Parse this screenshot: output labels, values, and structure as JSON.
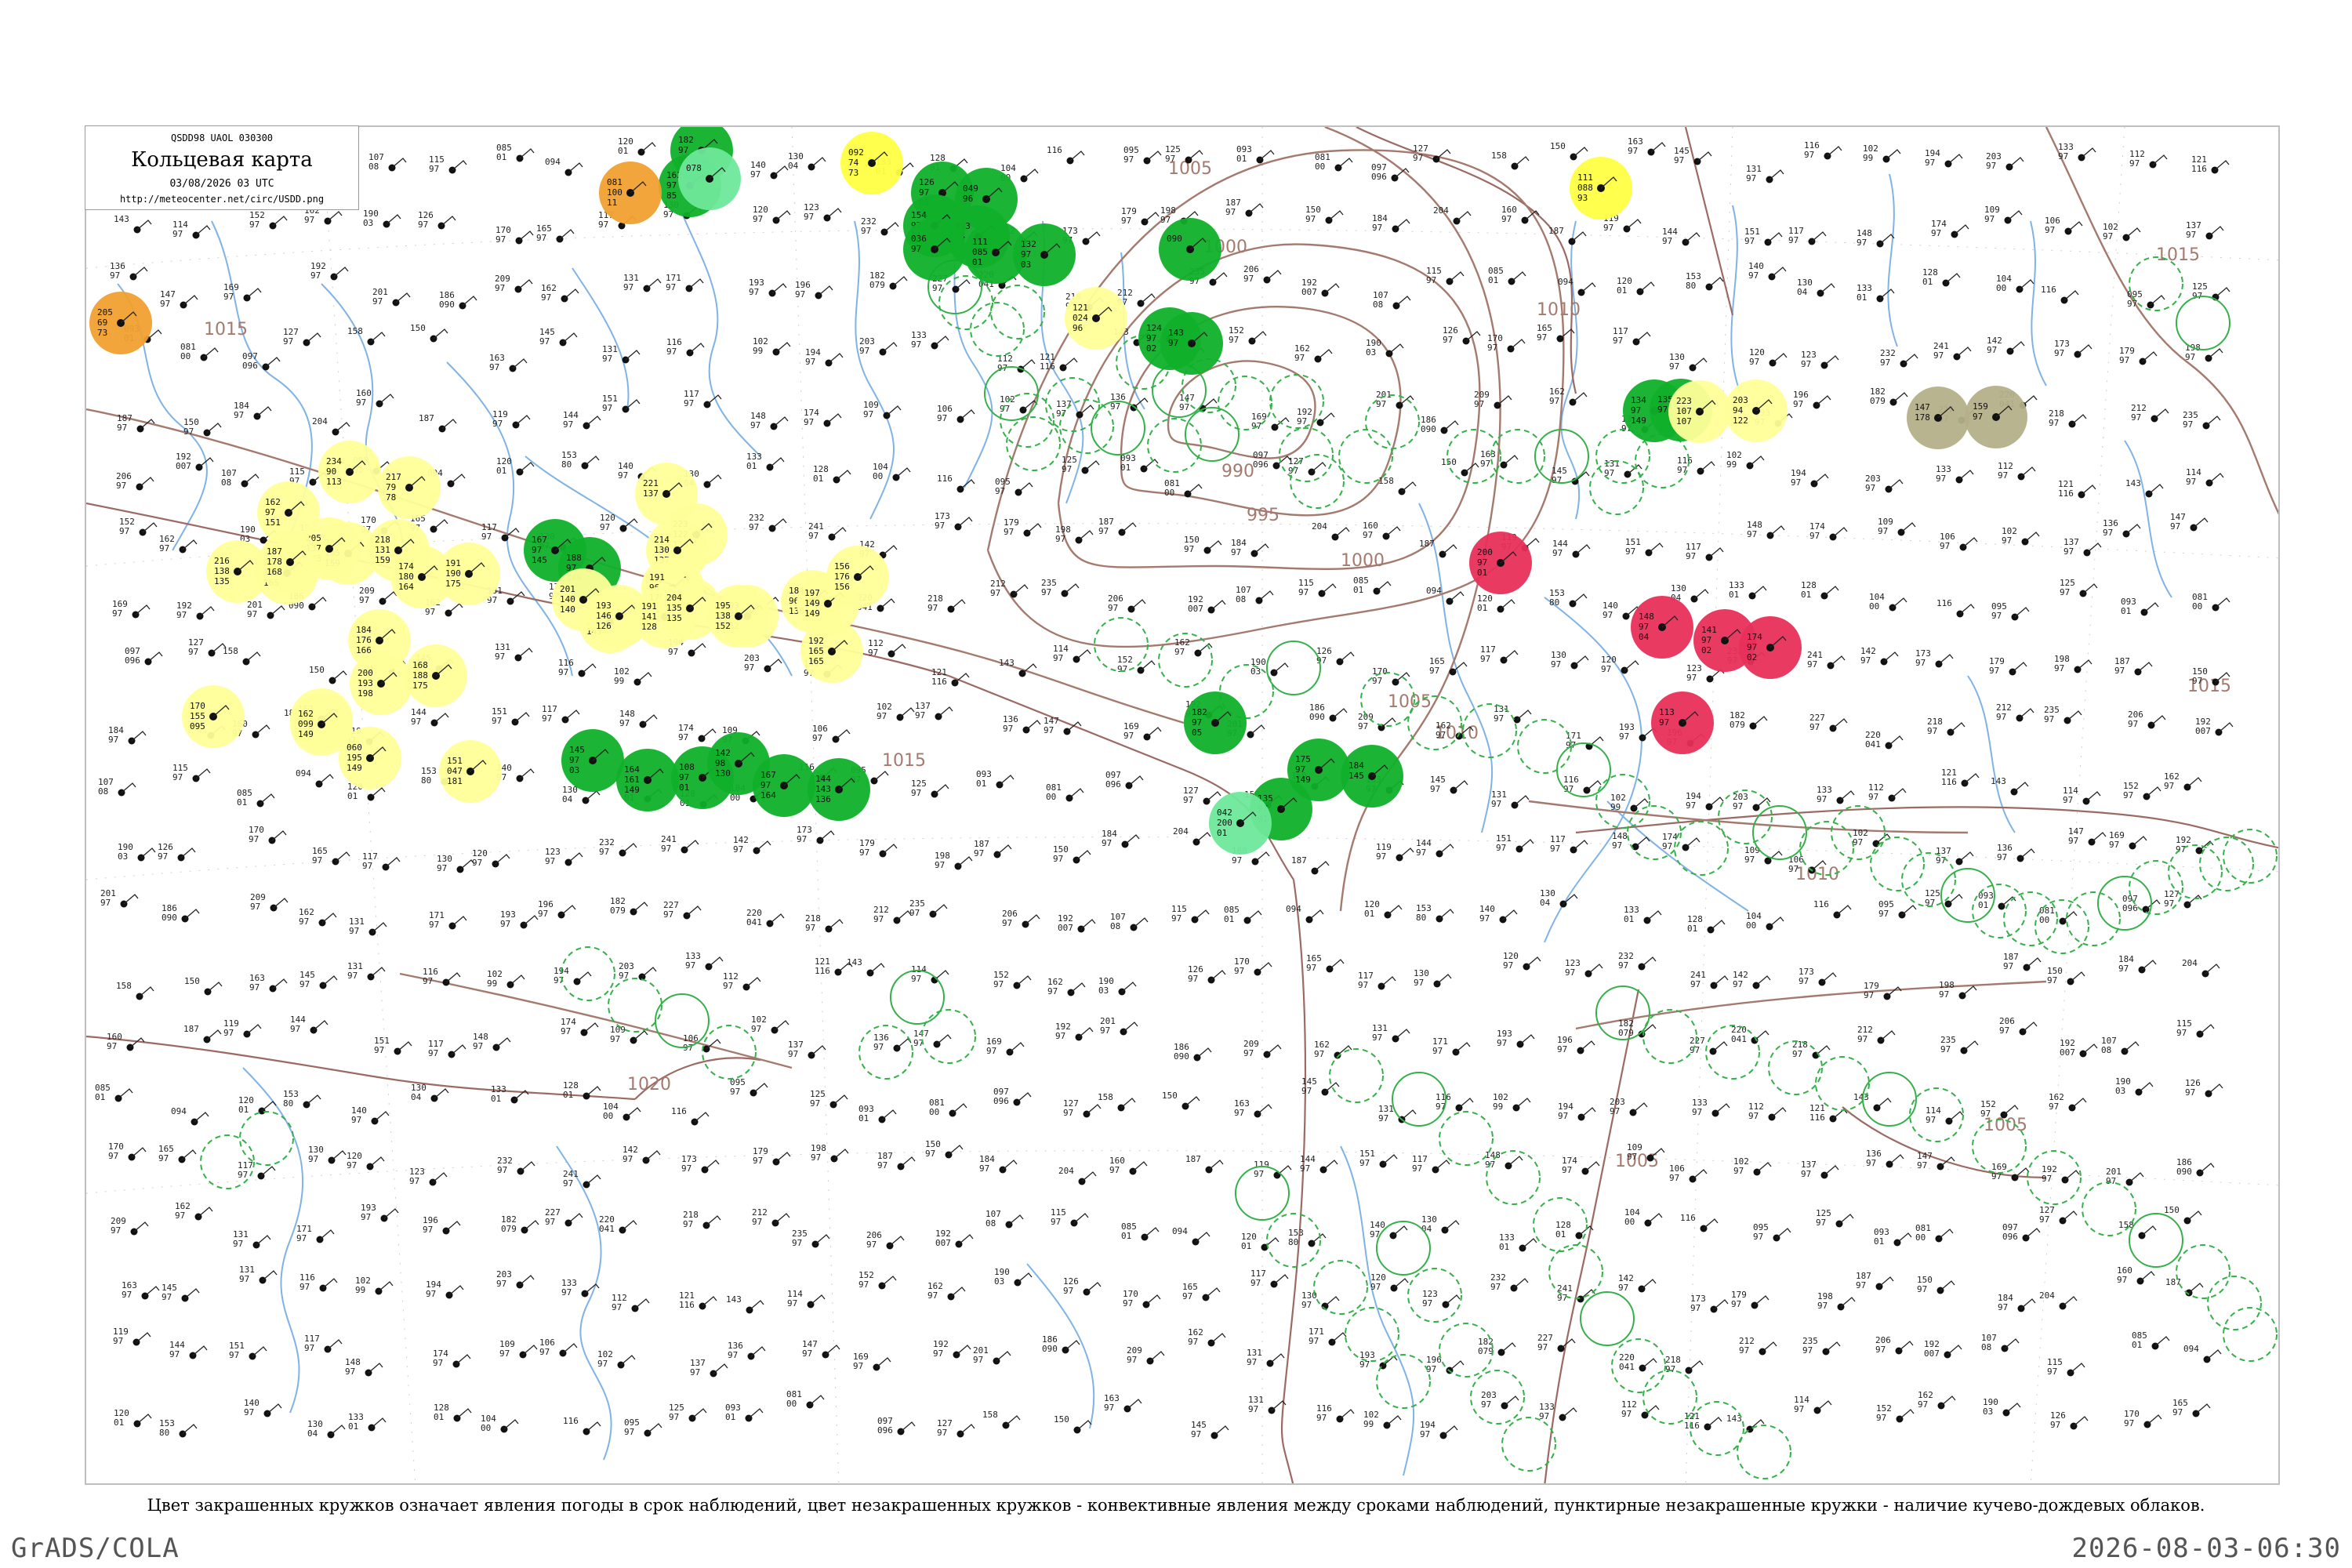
{
  "header": {
    "codes": "QSDD98  UAOL  030300",
    "title": "Кольцевая карта",
    "datetime": "03/08/2026 03 UTC",
    "url": "http://meteocenter.net/circ/USDD.png"
  },
  "caption": "Цвет закрашенных кружков означает явления погоды в срок наблюдений, цвет незакрашенных кружков - конвективные явления между сроками наблюдений, пунктирные незакрашенные кружки - наличие кучево-дождевых облаков.",
  "footer": {
    "left": "GrADS/COLA",
    "right": "2026-08-03-06:30"
  },
  "colors": {
    "frame": "#bfbfbf",
    "river": "#7fb3e6",
    "border": "#9b6a63",
    "isobar": "#a47a6e",
    "rain": "#10b02a",
    "shower_light": "#ffff44",
    "drizzle_pale": "#ffff99",
    "haze": "#f0a030",
    "fog": "#6ee89a",
    "thunder": "#e8305a",
    "dust": "#b5b08a",
    "convective_ring": "#35b04a"
  },
  "isobars": [
    {
      "label": "1005"
    },
    {
      "label": "1000"
    },
    {
      "label": "995"
    },
    {
      "label": "990"
    },
    {
      "label": "1010"
    },
    {
      "label": "1015"
    },
    {
      "label": "1020"
    }
  ],
  "weather_circles": [
    {
      "type": "rain",
      "values": [
        "182",
        "97",
        "93"
      ]
    },
    {
      "type": "rain",
      "values": [
        "162",
        "97",
        "85"
      ]
    },
    {
      "type": "shower_light",
      "values": [
        "092",
        "74",
        "73"
      ]
    },
    {
      "type": "haze",
      "values": [
        "081",
        "100",
        "11"
      ]
    },
    {
      "type": "fog",
      "values": [
        "078"
      ]
    },
    {
      "type": "rain",
      "values": [
        "126",
        "97",
        "08"
      ]
    },
    {
      "type": "rain",
      "values": [
        "049",
        "96"
      ]
    },
    {
      "type": "rain",
      "values": [
        "093",
        "84"
      ]
    },
    {
      "type": "rain",
      "values": [
        "154",
        "97",
        "11"
      ]
    },
    {
      "type": "rain",
      "values": [
        "036",
        "97"
      ]
    },
    {
      "type": "rain",
      "values": [
        "111",
        "085",
        "01"
      ]
    },
    {
      "type": "rain",
      "values": [
        "132",
        "97",
        "03"
      ]
    },
    {
      "type": "rain",
      "values": [
        "090"
      ]
    },
    {
      "type": "shower_light",
      "values": [
        "111",
        "088",
        "93"
      ]
    },
    {
      "type": "haze",
      "values": [
        "205",
        "69",
        "73"
      ]
    },
    {
      "type": "drizzle_pale",
      "values": [
        "121",
        "024",
        "96"
      ]
    },
    {
      "type": "rain",
      "values": [
        "124",
        "97",
        "02"
      ]
    },
    {
      "type": "rain",
      "values": [
        "143",
        "97"
      ]
    },
    {
      "type": "rain",
      "values": [
        "134",
        "97",
        "149"
      ]
    },
    {
      "type": "dust",
      "values": [
        "147",
        "178"
      ]
    },
    {
      "type": "dust",
      "values": [
        "159",
        "97"
      ]
    },
    {
      "type": "rain",
      "values": [
        "135",
        "97"
      ]
    },
    {
      "type": "drizzle_pale",
      "values": [
        "203",
        "94",
        "122"
      ]
    },
    {
      "type": "drizzle_pale",
      "values": [
        "223",
        "107",
        "107"
      ]
    },
    {
      "type": "drizzle_pale",
      "values": [
        "234",
        "90",
        "113"
      ]
    },
    {
      "type": "drizzle_pale",
      "values": [
        "217",
        "79",
        "78"
      ]
    },
    {
      "type": "drizzle_pale",
      "values": [
        "209",
        "105",
        "159"
      ]
    },
    {
      "type": "drizzle_pale",
      "values": [
        "205",
        "137",
        "133"
      ]
    },
    {
      "type": "drizzle_pale",
      "values": [
        "162",
        "97",
        "151"
      ]
    },
    {
      "type": "drizzle_pale",
      "values": [
        "218",
        "131",
        "159"
      ]
    },
    {
      "type": "drizzle_pale",
      "values": [
        "221",
        "137"
      ]
    },
    {
      "type": "drizzle_pale",
      "values": [
        "223",
        "122",
        "119"
      ]
    },
    {
      "type": "drizzle_pale",
      "values": [
        "214",
        "130",
        "137"
      ]
    },
    {
      "type": "drizzle_pale",
      "values": [
        "216",
        "138",
        "135"
      ]
    },
    {
      "type": "drizzle_pale",
      "values": [
        "206",
        "153",
        "165"
      ]
    },
    {
      "type": "drizzle_pale",
      "values": [
        "187",
        "178",
        "168"
      ]
    },
    {
      "type": "drizzle_pale",
      "values": [
        "174",
        "180",
        "164"
      ]
    },
    {
      "type": "drizzle_pale",
      "values": [
        "191",
        "190",
        "175"
      ]
    },
    {
      "type": "rain",
      "values": [
        "167",
        "97",
        "145"
      ]
    },
    {
      "type": "rain",
      "values": [
        "188",
        "97",
        "149"
      ]
    },
    {
      "type": "drizzle_pale",
      "values": [
        "191",
        "96",
        "179"
      ]
    },
    {
      "type": "drizzle_pale",
      "values": [
        "192",
        "160",
        "145"
      ]
    },
    {
      "type": "drizzle_pale",
      "values": [
        "201",
        "140",
        "140"
      ]
    },
    {
      "type": "drizzle_pale",
      "values": [
        "193",
        "146",
        "126"
      ]
    },
    {
      "type": "drizzle_pale",
      "values": [
        "191",
        "141",
        "128"
      ]
    },
    {
      "type": "drizzle_pale",
      "values": [
        "204",
        "135",
        "135"
      ]
    },
    {
      "type": "drizzle_pale",
      "values": [
        "193",
        "138",
        "152"
      ]
    },
    {
      "type": "drizzle_pale",
      "values": [
        "195",
        "138",
        "152"
      ]
    },
    {
      "type": "drizzle_pale",
      "values": [
        "184",
        "96",
        "138"
      ]
    },
    {
      "type": "drizzle_pale",
      "values": [
        "197",
        "149",
        "149"
      ]
    },
    {
      "type": "drizzle_pale",
      "values": [
        "192",
        "165",
        "165"
      ]
    },
    {
      "type": "drizzle_pale",
      "values": [
        "156",
        "176",
        "156"
      ]
    },
    {
      "type": "drizzle_pale",
      "values": [
        "184",
        "176",
        "166"
      ]
    },
    {
      "type": "drizzle_pale",
      "values": [
        "168",
        "188",
        "175"
      ]
    },
    {
      "type": "drizzle_pale",
      "values": [
        "200",
        "193",
        "198"
      ]
    },
    {
      "type": "drizzle_pale",
      "values": [
        "157",
        "103",
        "159"
      ]
    },
    {
      "type": "drizzle_pale",
      "values": [
        "170",
        "155",
        "095"
      ]
    },
    {
      "type": "drizzle_pale",
      "values": [
        "162",
        "099",
        "149"
      ]
    },
    {
      "type": "drizzle_pale",
      "values": [
        "060",
        "195",
        "149"
      ]
    },
    {
      "type": "drizzle_pale",
      "values": [
        "151",
        "047",
        "181"
      ]
    },
    {
      "type": "rain",
      "values": [
        "145",
        "97",
        "03"
      ]
    },
    {
      "type": "rain",
      "values": [
        "164",
        "161",
        "149"
      ]
    },
    {
      "type": "rain",
      "values": [
        "108",
        "97",
        "01"
      ]
    },
    {
      "type": "rain",
      "values": [
        "142",
        "98",
        "130"
      ]
    },
    {
      "type": "rain",
      "values": [
        "167",
        "97",
        "164"
      ]
    },
    {
      "type": "rain",
      "values": [
        "144",
        "143",
        "136"
      ]
    },
    {
      "type": "rain",
      "values": [
        "182",
        "97",
        "05"
      ]
    },
    {
      "type": "rain",
      "values": [
        "175",
        "97",
        "149"
      ]
    },
    {
      "type": "rain",
      "values": [
        "184",
        "145"
      ]
    },
    {
      "type": "rain",
      "values": [
        "135",
        "97",
        "01"
      ]
    },
    {
      "type": "fog",
      "values": [
        "042",
        "200",
        "01"
      ]
    },
    {
      "type": "thunder",
      "values": [
        "113",
        "97"
      ]
    },
    {
      "type": "thunder",
      "values": [
        "148",
        "97",
        "04"
      ]
    },
    {
      "type": "thunder",
      "values": [
        "141",
        "97",
        "02"
      ]
    },
    {
      "type": "thunder",
      "values": [
        "174",
        "97",
        "02"
      ]
    },
    {
      "type": "thunder",
      "values": [
        "200",
        "97",
        "01"
      ]
    }
  ],
  "stations": [
    {
      "values": [
        "107",
        "08"
      ]
    },
    {
      "values": [
        "115",
        "97"
      ]
    },
    {
      "values": [
        "085",
        "01"
      ]
    },
    {
      "values": [
        "094"
      ]
    },
    {
      "values": [
        "120",
        "01"
      ]
    },
    {
      "values": [
        "153",
        "80"
      ]
    },
    {
      "values": [
        "140",
        "97"
      ]
    },
    {
      "values": [
        "130",
        "04"
      ]
    },
    {
      "values": [
        "133",
        "01"
      ]
    },
    {
      "values": [
        "128",
        "01"
      ]
    },
    {
      "values": [
        "104",
        "00"
      ]
    },
    {
      "values": [
        "116"
      ]
    },
    {
      "values": [
        "095",
        "97"
      ]
    },
    {
      "values": [
        "125",
        "97"
      ]
    },
    {
      "values": [
        "093",
        "01"
      ]
    },
    {
      "values": [
        "081",
        "00"
      ]
    },
    {
      "values": [
        "097",
        "096"
      ]
    },
    {
      "values": [
        "127",
        "97"
      ]
    },
    {
      "values": [
        "158"
      ]
    },
    {
      "values": [
        "150"
      ]
    },
    {
      "values": [
        "163",
        "97"
      ]
    },
    {
      "values": [
        "145",
        "97"
      ]
    },
    {
      "values": [
        "131",
        "97"
      ]
    },
    {
      "values": [
        "116",
        "97"
      ]
    },
    {
      "values": [
        "102",
        "99"
      ]
    },
    {
      "values": [
        "194",
        "97"
      ]
    },
    {
      "values": [
        "203",
        "97"
      ]
    },
    {
      "values": [
        "133",
        "97"
      ]
    },
    {
      "values": [
        "112",
        "97"
      ]
    },
    {
      "values": [
        "121",
        "116"
      ]
    },
    {
      "values": [
        "143"
      ]
    },
    {
      "values": [
        "114",
        "97"
      ]
    },
    {
      "values": [
        "152",
        "97"
      ]
    },
    {
      "values": [
        "162",
        "97"
      ]
    },
    {
      "values": [
        "190",
        "03"
      ]
    },
    {
      "values": [
        "126",
        "97"
      ]
    },
    {
      "values": [
        "170",
        "97"
      ]
    },
    {
      "values": [
        "165",
        "97"
      ]
    },
    {
      "values": [
        "117",
        "97"
      ]
    },
    {
      "values": [
        "130",
        "97"
      ]
    },
    {
      "values": [
        "120",
        "97"
      ]
    },
    {
      "values": [
        "123",
        "97"
      ]
    },
    {
      "values": [
        "232",
        "97"
      ]
    },
    {
      "values": [
        "241",
        "97"
      ]
    },
    {
      "values": [
        "142",
        "97"
      ]
    },
    {
      "values": [
        "173",
        "97"
      ]
    },
    {
      "values": [
        "179",
        "97"
      ]
    },
    {
      "values": [
        "198",
        "97"
      ]
    },
    {
      "values": [
        "187",
        "97"
      ]
    },
    {
      "values": [
        "150",
        "97"
      ]
    },
    {
      "values": [
        "184",
        "97"
      ]
    },
    {
      "values": [
        "204"
      ]
    },
    {
      "values": [
        "160",
        "97"
      ]
    },
    {
      "values": [
        "187"
      ]
    },
    {
      "values": [
        "119",
        "97"
      ]
    },
    {
      "values": [
        "144",
        "97"
      ]
    },
    {
      "values": [
        "151",
        "97"
      ]
    },
    {
      "values": [
        "117",
        "97"
      ]
    },
    {
      "values": [
        "148",
        "97"
      ]
    },
    {
      "values": [
        "174",
        "97"
      ]
    },
    {
      "values": [
        "109",
        "97"
      ]
    },
    {
      "values": [
        "106",
        "97"
      ]
    },
    {
      "values": [
        "102",
        "97"
      ]
    },
    {
      "values": [
        "137",
        "97"
      ]
    },
    {
      "values": [
        "136",
        "97"
      ]
    },
    {
      "values": [
        "147",
        "97"
      ]
    },
    {
      "values": [
        "169",
        "97"
      ]
    },
    {
      "values": [
        "192",
        "97"
      ]
    },
    {
      "values": [
        "201",
        "97"
      ]
    },
    {
      "values": [
        "186",
        "090"
      ]
    },
    {
      "values": [
        "209",
        "97"
      ]
    },
    {
      "values": [
        "162",
        "97"
      ]
    },
    {
      "values": [
        "131",
        "97"
      ]
    },
    {
      "values": [
        "171",
        "97"
      ]
    },
    {
      "values": [
        "193",
        "97"
      ]
    },
    {
      "values": [
        "196",
        "97"
      ]
    },
    {
      "values": [
        "182",
        "079"
      ]
    },
    {
      "values": [
        "227",
        "97"
      ]
    },
    {
      "values": [
        "220",
        "041"
      ]
    },
    {
      "values": [
        "218",
        "97"
      ]
    },
    {
      "values": [
        "212",
        "97"
      ]
    },
    {
      "values": [
        "235",
        "97"
      ]
    },
    {
      "values": [
        "206",
        "97"
      ]
    },
    {
      "values": [
        "192",
        "007"
      ]
    }
  ]
}
